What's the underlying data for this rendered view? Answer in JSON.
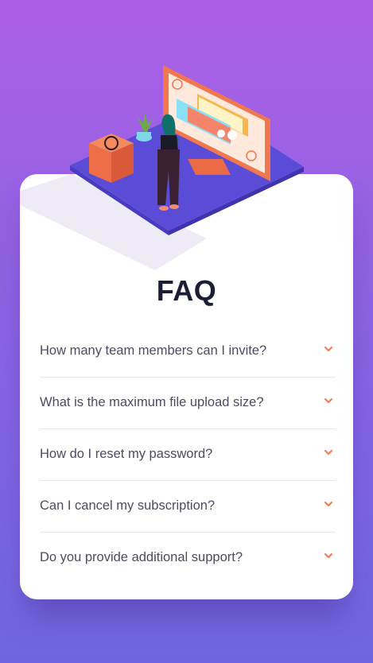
{
  "faq": {
    "title": "FAQ",
    "items": [
      {
        "question": "How many team members can I invite?"
      },
      {
        "question": "What is the maximum file upload size?"
      },
      {
        "question": "How do I reset my password?"
      },
      {
        "question": "Can I cancel my subscription?"
      },
      {
        "question": "Do you provide additional support?"
      }
    ]
  },
  "colors": {
    "background_top": "#ad5fe6",
    "background_bottom": "#6e66e0",
    "card": "#ffffff",
    "title": "#1d1e35",
    "question": "#4b4c5f",
    "chevron": "#f47c57"
  }
}
